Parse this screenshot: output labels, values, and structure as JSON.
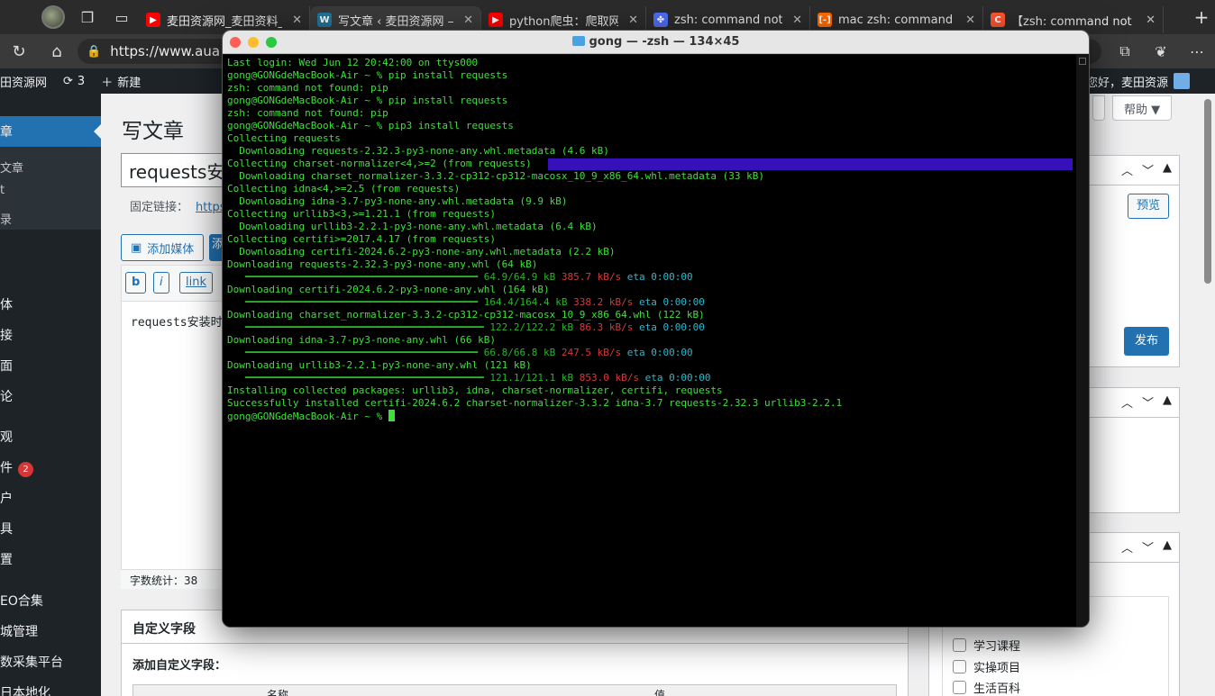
{
  "browser": {
    "tabs": [
      {
        "title": "麦田资源网_麦田资料_",
        "icon": "youtube-icon",
        "color": "#ff0000",
        "active": false
      },
      {
        "title": "写文章 ‹ 麦田资源网 —",
        "icon": "wordpress-icon",
        "color": "#21759b",
        "active": true
      },
      {
        "title": "python爬虫：爬取网页",
        "icon": "youtube-icon",
        "color": "#ff0000",
        "active": false
      },
      {
        "title": "zsh: command not fou",
        "icon": "paw-icon",
        "color": "#4e6ef2",
        "active": false
      },
      {
        "title": "mac zsh: command no",
        "icon": "bracket-icon",
        "color": "#ff6a00",
        "active": false
      },
      {
        "title": "【zsh: command not f",
        "icon": "c-icon",
        "color": "#fc5531",
        "active": false
      }
    ],
    "url": "https://www.aua",
    "icons": [
      "refresh-icon",
      "home-icon",
      "lock-icon",
      "collections-icon",
      "copilot-icon",
      "more-icon"
    ]
  },
  "adminbar": {
    "site": "田资源网",
    "updates": "3",
    "new": "新建",
    "greeting": "您好，麦田资源"
  },
  "sidebar": {
    "current": "章",
    "subitems": [
      "文章",
      "t",
      "录"
    ],
    "items": [
      {
        "label": "体"
      },
      {
        "label": "接"
      },
      {
        "label": "面"
      },
      {
        "label": "论"
      },
      {
        "label": "观"
      },
      {
        "label": "件",
        "badge": "2"
      },
      {
        "label": "户"
      },
      {
        "label": "具"
      },
      {
        "label": "置"
      },
      {
        "label": "EO合集"
      },
      {
        "label": "城管理"
      },
      {
        "label": "数采集平台"
      },
      {
        "label": "日本地化"
      }
    ]
  },
  "editor": {
    "page_title": "写文章",
    "post_title": "requests安",
    "permalink_label": "固定链接：",
    "permalink_url": "https:",
    "add_media": "添加媒体",
    "add_media2": "添",
    "quicktags": [
      "b",
      "i",
      "link"
    ],
    "content": "requests安装时",
    "word_count": "字数统计：38",
    "custom_fields_title": "自定义字段",
    "custom_fields_sub": "添加自定义字段：",
    "cf_col_name": "名称",
    "cf_col_value": "值",
    "help": "帮助 ▼"
  },
  "publish_box": {
    "preview": "预览",
    "publish": "发布"
  },
  "categories": [
    "学习课程",
    "实操项目",
    "生活百科"
  ],
  "terminal": {
    "title": "gong — -zsh — 134×45",
    "lines": [
      "Last login: Wed Jun 12 20:42:00 on ttys000",
      "gong@GONGdeMacBook-Air ~ % pip install requests",
      "zsh: command not found: pip",
      "gong@GONGdeMacBook-Air ~ % pip install requests",
      "zsh: command not found: pip",
      "gong@GONGdeMacBook-Air ~ % pip3 install requests",
      "Collecting requests",
      "  Downloading requests-2.32.3-py3-none-any.whl.metadata (4.6 kB)",
      "Collecting charset-normalizer<4,>=2 (from requests)",
      "  Downloading charset_normalizer-3.3.2-cp312-cp312-macosx_10_9_x86_64.whl.metadata (33 kB)",
      "Collecting idna<4,>=2.5 (from requests)",
      "  Downloading idna-3.7-py3-none-any.whl.metadata (9.9 kB)",
      "Collecting urllib3<3,>=1.21.1 (from requests)",
      "  Downloading urllib3-2.2.1-py3-none-any.whl.metadata (6.4 kB)",
      "Collecting certifi>=2017.4.17 (from requests)",
      "  Downloading certifi-2024.6.2-py3-none-any.whl.metadata (2.2 kB)",
      "Downloading requests-2.32.3-py3-none-any.whl (64 kB)"
    ],
    "progress": [
      {
        "bar": "   ━━━━━━━━━━━━━━━━━━━━━━━━━━━━━━━━━━━━━━━ ",
        "size": "64.9/64.9 kB",
        "speed": "385.7 kB/s",
        "eta": "eta 0:00:00",
        "after": "Downloading certifi-2024.6.2-py3-none-any.whl (164 kB)"
      },
      {
        "bar": "   ━━━━━━━━━━━━━━━━━━━━━━━━━━━━━━━━━━━━━━━ ",
        "size": "164.4/164.4 kB",
        "speed": "338.2 kB/s",
        "eta": "eta 0:00:00",
        "after": "Downloading charset_normalizer-3.3.2-cp312-cp312-macosx_10_9_x86_64.whl (122 kB)"
      },
      {
        "bar": "   ━━━━━━━━━━━━━━━━━━━━━━━━━━━━━━━━━━━━━━━━ ",
        "size": "122.2/122.2 kB",
        "speed": "86.3 kB/s",
        "eta": "eta 0:00:00",
        "after": "Downloading idna-3.7-py3-none-any.whl (66 kB)"
      },
      {
        "bar": "   ━━━━━━━━━━━━━━━━━━━━━━━━━━━━━━━━━━━━━━━ ",
        "size": "66.8/66.8 kB",
        "speed": "247.5 kB/s",
        "eta": "eta 0:00:00",
        "after": "Downloading urllib3-2.2.1-py3-none-any.whl (121 kB)"
      },
      {
        "bar": "   ━━━━━━━━━━━━━━━━━━━━━━━━━━━━━━━━━━━━━━━━ ",
        "size": "121.1/121.1 kB",
        "speed": "853.0 kB/s",
        "eta": "eta 0:00:00",
        "after": ""
      }
    ],
    "tail": [
      "Installing collected packages: urllib3, idna, charset-normalizer, certifi, requests",
      "Successfully installed certifi-2024.6.2 charset-normalizer-3.3.2 idna-3.7 requests-2.32.3 urllib3-2.2.1",
      "gong@GONGdeMacBook-Air ~ % "
    ]
  }
}
